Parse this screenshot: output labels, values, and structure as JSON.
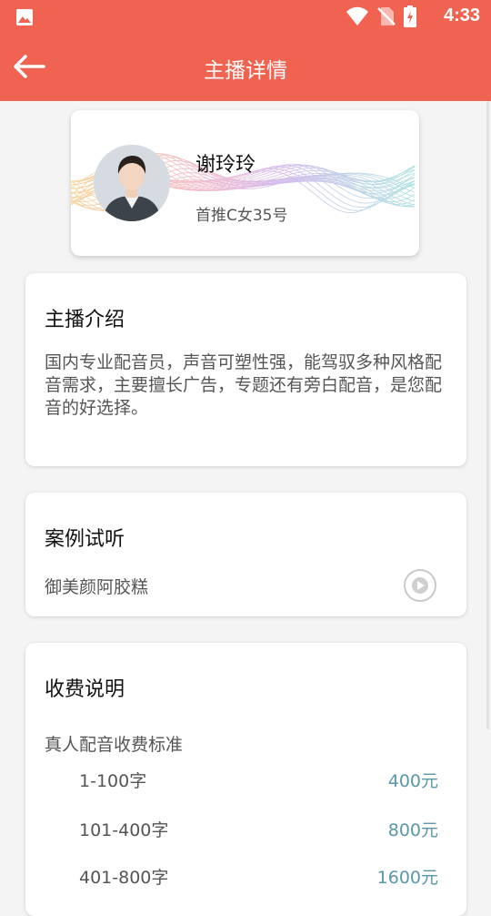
{
  "status_bar": {
    "time": "4:33",
    "icons": [
      "gallery-icon",
      "wifi-icon",
      "no-sim-icon",
      "battery-icon"
    ]
  },
  "app_bar": {
    "title": "主播详情",
    "back_icon": "arrow-left-icon"
  },
  "profile": {
    "name": "谢玲玲",
    "anchor_id": "首推C女35号"
  },
  "intro": {
    "title": "主播介绍",
    "text": "国内专业配音员，声音可塑性强，能驾驭多种风格配音需求，主要擅长广告，专题还有旁白配音，是您配音的好选择。"
  },
  "cases": {
    "title": "案例试听",
    "items": [
      {
        "name": "御美颜阿胶糕",
        "icon": "play-icon"
      }
    ]
  },
  "fees": {
    "title": "收费说明",
    "subtitle": "真人配音收费标准",
    "rows": [
      {
        "range": "1-100字",
        "price": "400元"
      },
      {
        "range": "101-400字",
        "price": "800元"
      },
      {
        "range": "401-800字",
        "price": "1600元"
      }
    ]
  },
  "colors": {
    "primary": "#ef6350",
    "price": "#5a97a8",
    "background": "#f4f4f4"
  }
}
